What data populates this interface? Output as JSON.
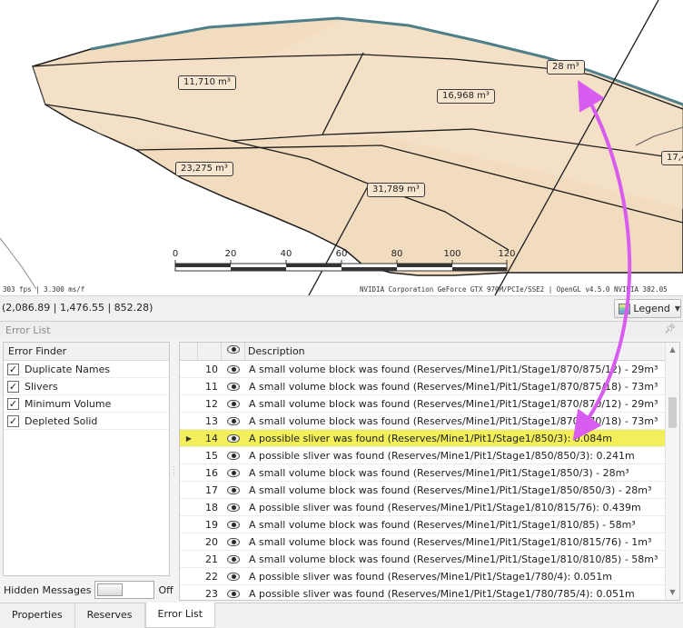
{
  "viewport": {
    "volumes": [
      "11,710 m³",
      "16,968 m³",
      "28 m³",
      "23,275 m³",
      "31,789 m³",
      "17,4"
    ],
    "scale_ticks": [
      "0",
      "20",
      "40",
      "60",
      "80",
      "100",
      "120"
    ],
    "fps_text": "303 fps | 3.300 ms/f",
    "gpu_text": "NVIDIA Corporation GeForce GTX 970M/PCIe/SSE2 | OpenGL v4.5.0 NVIDIA 382.05"
  },
  "statusbar": {
    "coords": "(2,086.89 | 1,476.55 | 852.28)",
    "legend_label": "Legend"
  },
  "panel": {
    "title": "Error List",
    "finder": {
      "header": "Error Finder",
      "items": [
        {
          "label": "Duplicate Names",
          "checked": true
        },
        {
          "label": "Slivers",
          "checked": true
        },
        {
          "label": "Minimum Volume",
          "checked": true
        },
        {
          "label": "Depleted Solid",
          "checked": true
        }
      ]
    },
    "hidden_messages_label": "Hidden Messages",
    "hidden_messages_state": "Off",
    "grid": {
      "description_header": "Description",
      "rows": [
        {
          "num": "10",
          "desc": "A small volume block was found (Reserves/Mine1/Pit1/Stage1/870/875/12) - 29m³"
        },
        {
          "num": "11",
          "desc": "A small volume block was found (Reserves/Mine1/Pit1/Stage1/870/875/18) - 73m³"
        },
        {
          "num": "12",
          "desc": "A small volume block was found (Reserves/Mine1/Pit1/Stage1/870/870/12) - 29m³"
        },
        {
          "num": "13",
          "desc": "A small volume block was found (Reserves/Mine1/Pit1/Stage1/870/870/18) - 73m³"
        },
        {
          "num": "14",
          "desc": "A possible sliver was found (Reserves/Mine1/Pit1/Stage1/850/3): 0.084m",
          "selected": true
        },
        {
          "num": "15",
          "desc": "A possible sliver was found (Reserves/Mine1/Pit1/Stage1/850/850/3): 0.241m"
        },
        {
          "num": "16",
          "desc": "A small volume block was found (Reserves/Mine1/Pit1/Stage1/850/3) - 28m³"
        },
        {
          "num": "17",
          "desc": "A small volume block was found (Reserves/Mine1/Pit1/Stage1/850/850/3) - 28m³"
        },
        {
          "num": "18",
          "desc": "A possible sliver was found (Reserves/Mine1/Pit1/Stage1/810/815/76): 0.439m"
        },
        {
          "num": "19",
          "desc": "A small volume block was found (Reserves/Mine1/Pit1/Stage1/810/85) - 58m³"
        },
        {
          "num": "20",
          "desc": "A small volume block was found (Reserves/Mine1/Pit1/Stage1/810/815/76) - 1m³"
        },
        {
          "num": "21",
          "desc": "A small volume block was found (Reserves/Mine1/Pit1/Stage1/810/810/85) - 58m³"
        },
        {
          "num": "22",
          "desc": "A possible sliver was found (Reserves/Mine1/Pit1/Stage1/780/4): 0.051m"
        },
        {
          "num": "23",
          "desc": "A possible sliver was found (Reserves/Mine1/Pit1/Stage1/780/785/4): 0.051m"
        }
      ]
    }
  },
  "tabs": [
    {
      "label": "Properties"
    },
    {
      "label": "Reserves"
    },
    {
      "label": "Error List",
      "active": true
    }
  ],
  "colors": {
    "solid_fill": "#f2dcc0",
    "selected_row": "#f2ef5a",
    "annotation_arrow": "#d95cf0"
  }
}
